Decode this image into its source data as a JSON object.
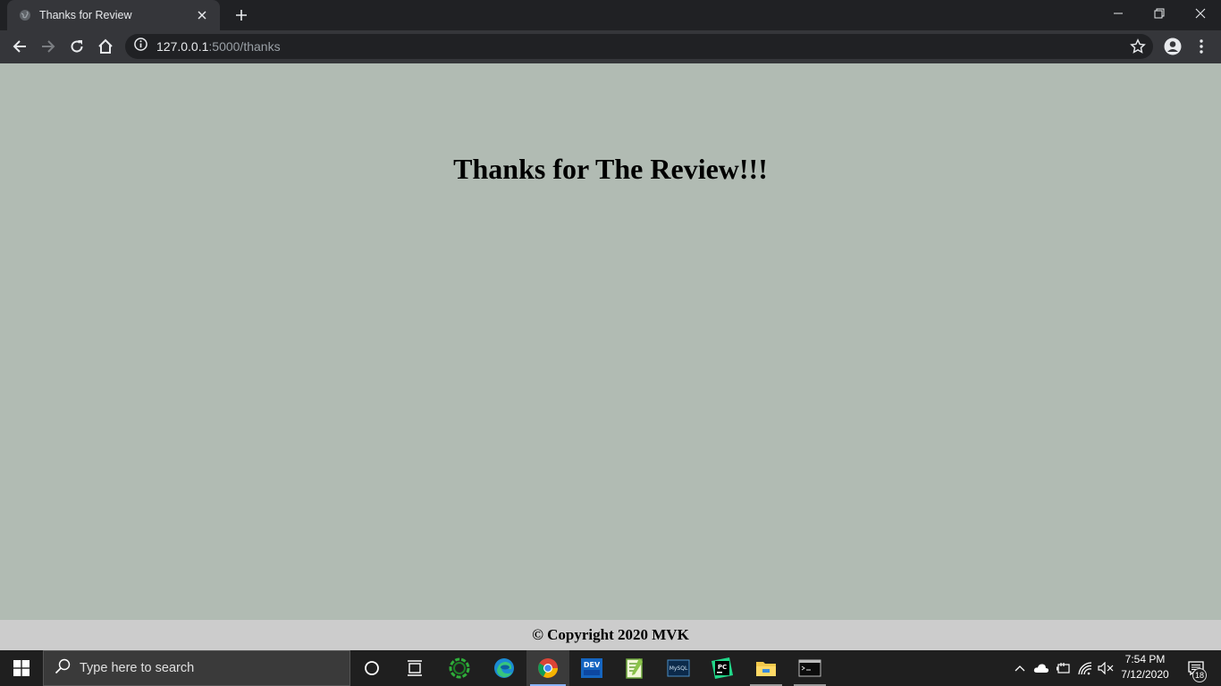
{
  "browser": {
    "tab_title": "Thanks for Review",
    "url_host": "127.0.0.1",
    "url_path": ":5000/thanks"
  },
  "page": {
    "heading": "Thanks for The Review!!!",
    "footer": "© Copyright 2020 MVK",
    "background": "#b1bbb3",
    "footer_background": "#cccccc"
  },
  "taskbar": {
    "search_placeholder": "Type here to search",
    "time": "7:54 PM",
    "date": "7/12/2020",
    "notification_count": "18",
    "pinned_apps": [
      "cortana-icon",
      "task-view-icon",
      "sync-app-icon",
      "edge-icon",
      "chrome-icon",
      "dev-icon",
      "notepad-plus-icon",
      "mysql-icon",
      "pycharm-icon",
      "file-explorer-icon",
      "terminal-icon"
    ]
  }
}
